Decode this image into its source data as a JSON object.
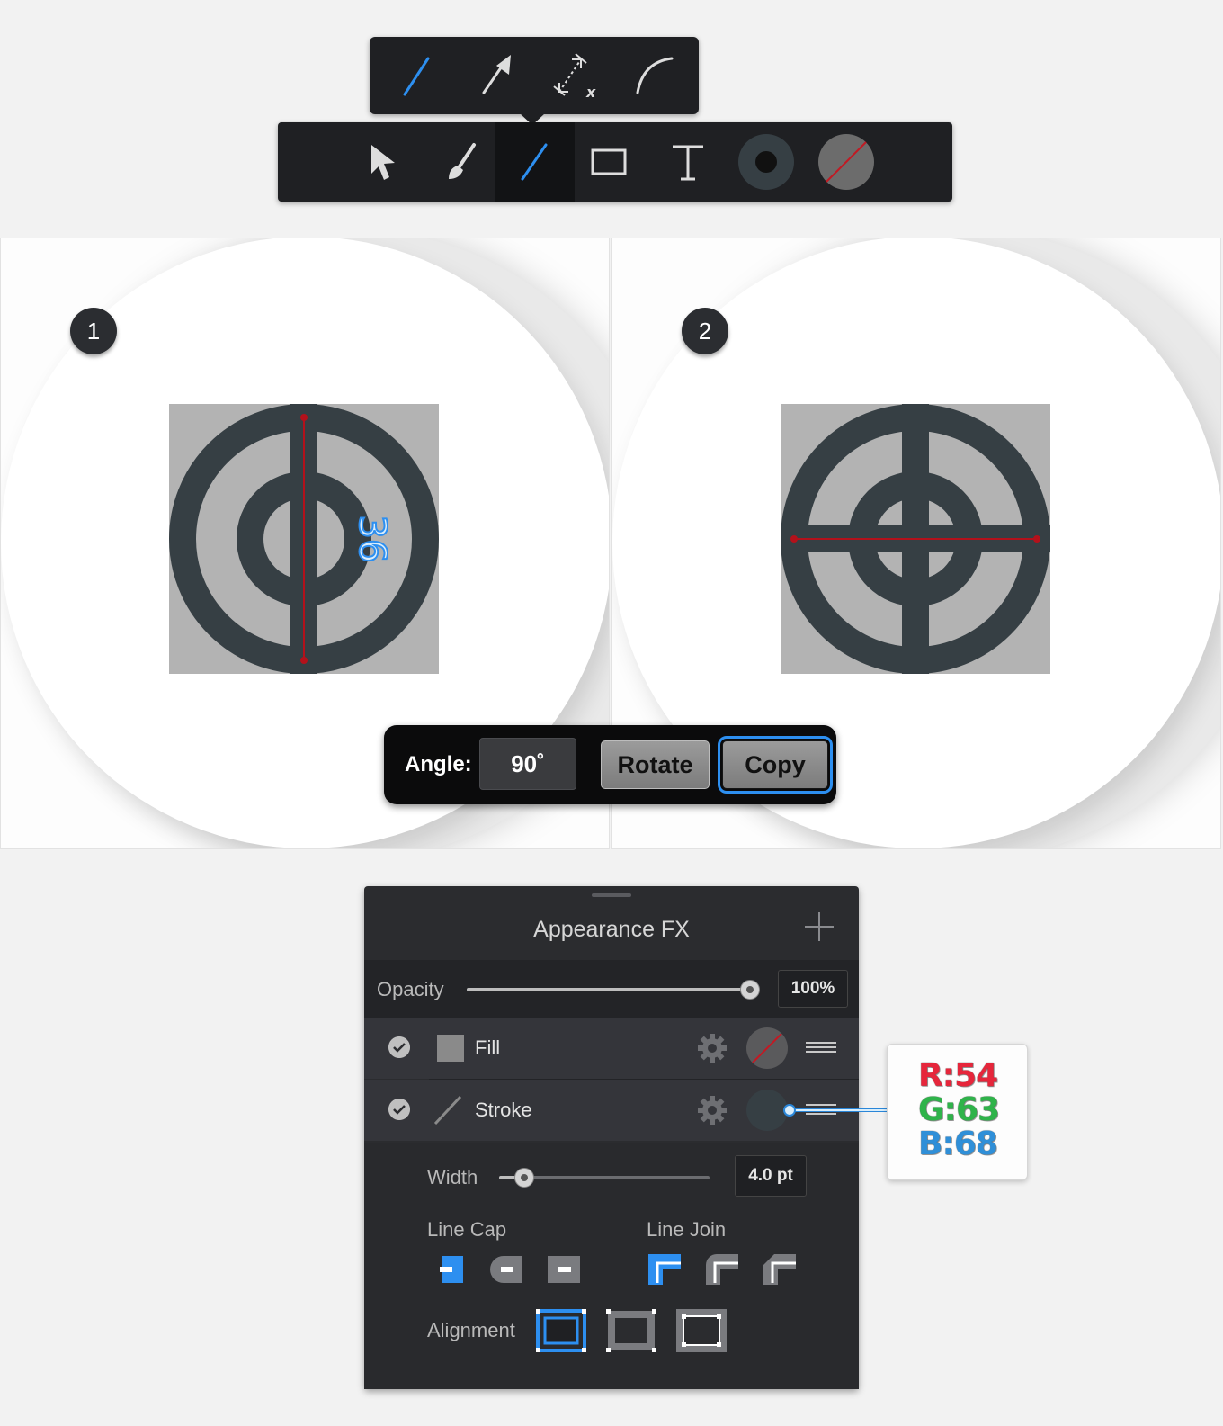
{
  "toolbar": {
    "popup_tools": [
      "line-tool",
      "arrow-tool",
      "dimension-tool",
      "arc-tool"
    ],
    "tools": [
      "select-tool",
      "brush-tool",
      "line-tool",
      "rectangle-tool",
      "text-tool",
      "fill-color",
      "stroke-color"
    ],
    "active_tool": "line-tool",
    "accent_color": "#2d8ff0"
  },
  "canvas": {
    "step1": {
      "badge": "1",
      "dimension_label": "36"
    },
    "step2": {
      "badge": "2"
    },
    "icon_color": "#363f44",
    "icon_background": "#b3b3b3",
    "guide_line_color": "#b3111b"
  },
  "angle_bar": {
    "label": "Angle:",
    "value": "90˚",
    "rotate_label": "Rotate",
    "copy_label": "Copy"
  },
  "appearance": {
    "title": "Appearance FX",
    "opacity": {
      "label": "Opacity",
      "value": "100%",
      "level": 1.0
    },
    "layers": [
      {
        "name": "Fill",
        "enabled": true
      },
      {
        "name": "Stroke",
        "enabled": true
      }
    ],
    "width": {
      "label": "Width",
      "value": "4.0 pt",
      "level": 0.12
    },
    "line_cap_label": "Line Cap",
    "line_join_label": "Line Join",
    "alignment_label": "Alignment"
  },
  "color_tag": {
    "r": "R:54",
    "g": "G:63",
    "b": "B:68",
    "r_color": "#e6263b",
    "g_color": "#2fb34a",
    "b_color": "#2f8fd8"
  }
}
